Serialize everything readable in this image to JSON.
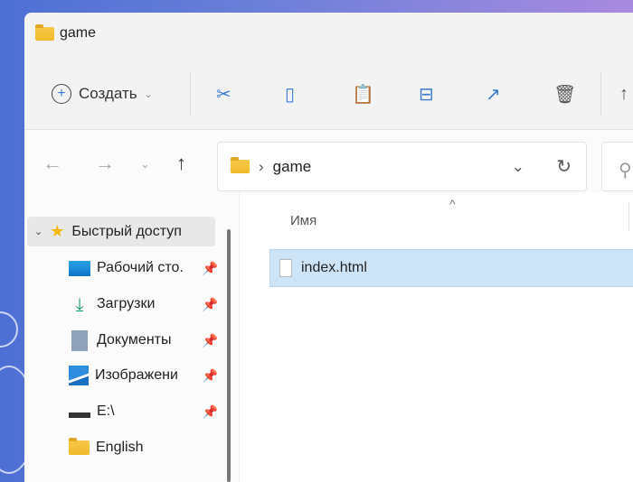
{
  "window": {
    "title": "game"
  },
  "toolbar": {
    "create_label": "Создать",
    "buttons": [
      "cut-icon",
      "copy-icon",
      "paste-icon",
      "rename-icon",
      "share-icon",
      "delete-icon"
    ]
  },
  "navigation": {
    "path": [
      "game"
    ]
  },
  "sidebar": {
    "quick_access": "Быстрый доступ",
    "items": [
      {
        "label": "Рабочий сто.",
        "icon": "desktop-icon",
        "pinned": true
      },
      {
        "label": "Загрузки",
        "icon": "download-icon",
        "pinned": true
      },
      {
        "label": "Документы",
        "icon": "documents-icon",
        "pinned": true
      },
      {
        "label": "Изображени",
        "icon": "pictures-icon",
        "pinned": true
      },
      {
        "label": "E:\\",
        "icon": "drive-icon",
        "pinned": true
      },
      {
        "label": "English",
        "icon": "folder-icon",
        "pinned": false
      }
    ]
  },
  "content": {
    "column_name": "Имя",
    "files": [
      {
        "name": "index.html",
        "selected": true
      }
    ]
  }
}
